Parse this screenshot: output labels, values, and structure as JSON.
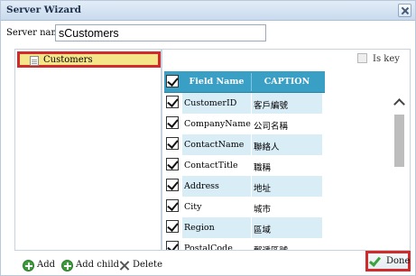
{
  "window": {
    "title": "Server Wizard"
  },
  "server": {
    "label": "Server name:",
    "value": "sCustomers"
  },
  "tree": {
    "items": [
      {
        "label": "Customers"
      }
    ]
  },
  "options": {
    "is_key_label": "Is key"
  },
  "grid": {
    "headers": {
      "field": "Field Name",
      "caption": "CAPTION"
    },
    "rows": [
      {
        "field": "CustomerID",
        "caption": "客戶編號"
      },
      {
        "field": "CompanyName",
        "caption": "公司名稱"
      },
      {
        "field": "ContactName",
        "caption": "聯絡人"
      },
      {
        "field": "ContactTitle",
        "caption": "職稱"
      },
      {
        "field": "Address",
        "caption": "地址"
      },
      {
        "field": "City",
        "caption": "城市"
      },
      {
        "field": "Region",
        "caption": "區域"
      },
      {
        "field": "PostalCode",
        "caption": "郵遞區號"
      }
    ]
  },
  "footer": {
    "add_label": "Add",
    "add_child_label": "Add child",
    "delete_label": "Delete",
    "done_label": "Done"
  }
}
